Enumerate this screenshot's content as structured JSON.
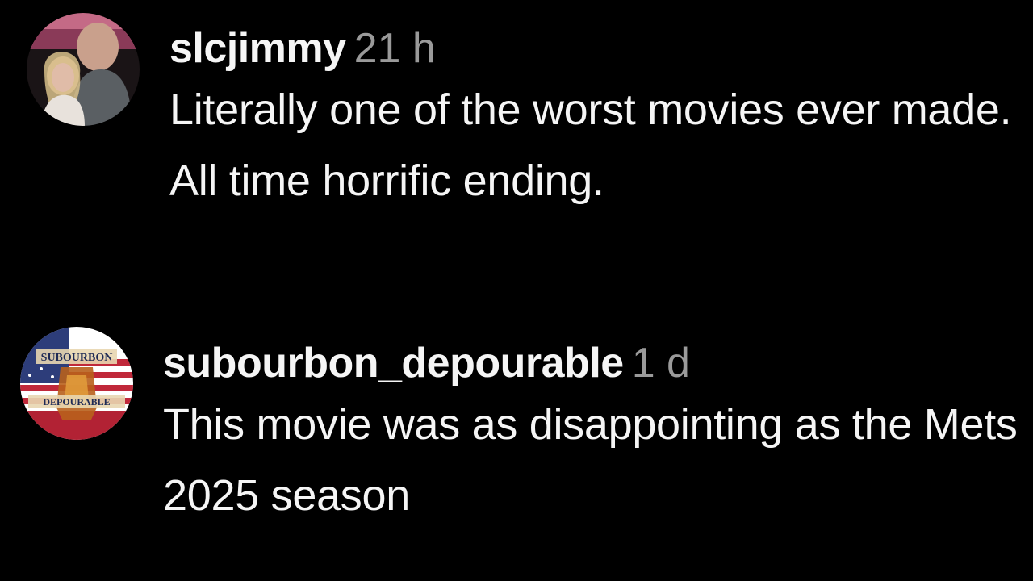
{
  "comments": [
    {
      "username": "slcjimmy",
      "time": "21 h",
      "text": "Literally one of the worst movies ever made. All time horrific ending."
    },
    {
      "username": "subourbon_depourable",
      "time": "1 d",
      "text": "This movie was as disappointing as the Mets 2025 season",
      "avatar_text_top": "SUBOURBON",
      "avatar_text_bottom": "DEPOURABLE"
    }
  ],
  "colors": {
    "background": "#000000",
    "username": "#f5f5f5",
    "timestamp": "#9a9a9a",
    "text": "#f5f5f5"
  }
}
